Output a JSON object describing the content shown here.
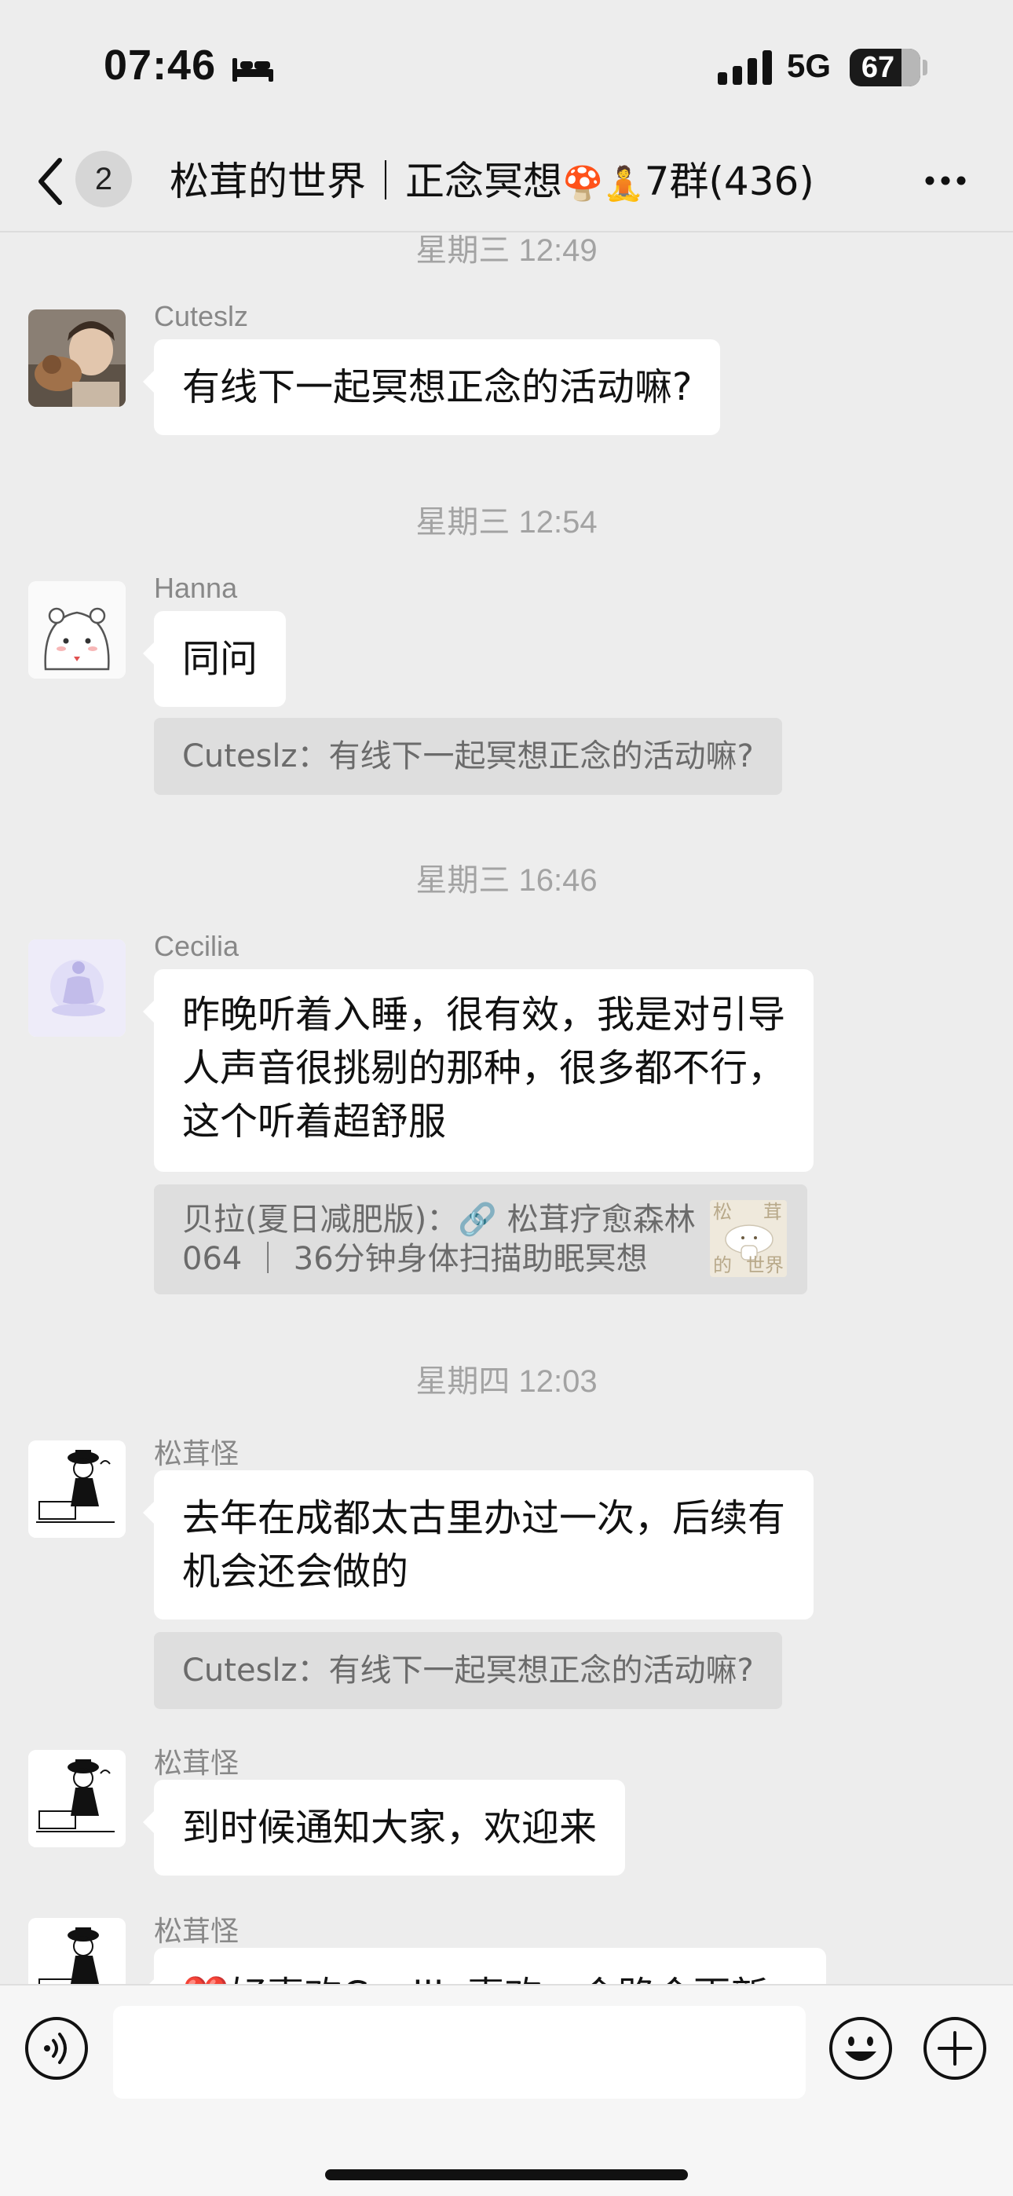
{
  "status_bar": {
    "time": "07:46",
    "network": "5G",
    "battery": "67"
  },
  "nav": {
    "unread_count": "2",
    "title_prefix": "松茸的世界｜正念冥想",
    "title_emoji": "🍄🧘",
    "title_suffix": "7群(436)"
  },
  "timestamps": [
    "星期三 12:49",
    "星期三 12:54",
    "星期三 16:46",
    "星期四 12:03"
  ],
  "messages": [
    {
      "sender": "Cuteslz",
      "lines": [
        "有线下一起冥想正念的活动嘛?"
      ]
    },
    {
      "sender": "Hanna",
      "lines": [
        "同问"
      ],
      "quote": "Cuteslz：有线下一起冥想正念的活动嘛?"
    },
    {
      "sender": "Cecilia",
      "lines": [
        "昨晚听着入睡，很有效，我是对引导",
        "人声音很挑剔的那种，很多都不行，",
        "这个听着超舒服"
      ],
      "quote_lines": [
        "贝拉(夏日减肥版)：🔗 松茸疗愈森林",
        "064 ｜ 36分钟身体扫描助眠冥想"
      ],
      "thumb_text": [
        "松",
        "茸",
        "的",
        "世界"
      ]
    },
    {
      "sender": "松茸怪",
      "lines": [
        "去年在成都太古里办过一次，后续有",
        "机会还会做的"
      ],
      "quote": "Cuteslz：有线下一起冥想正念的活动嘛?"
    },
    {
      "sender": "松茸怪",
      "lines": [
        "到时候通知大家，欢迎来"
      ]
    },
    {
      "sender": "松茸怪",
      "lines": [
        "❤️好喜欢Cecilia喜欢，会路会更新"
      ]
    }
  ],
  "icons": {
    "voice": "voice-icon",
    "emoji": "smiley-icon",
    "plus": "plus-icon",
    "back": "chevron-left-icon",
    "more": "more-dots-icon",
    "bed": "bed-icon"
  },
  "input": {
    "placeholder": ""
  }
}
